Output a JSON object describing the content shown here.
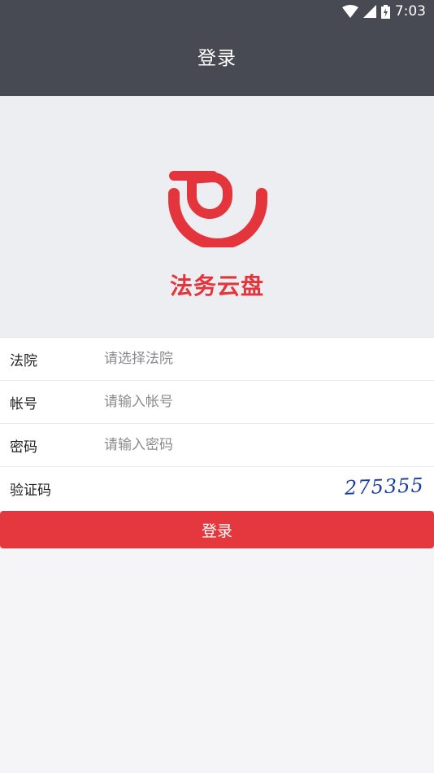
{
  "status_bar": {
    "time": "7:03",
    "icons": [
      "wifi-icon",
      "cell-signal-icon",
      "battery-icon"
    ]
  },
  "header": {
    "title": "登录"
  },
  "brand": {
    "name": "法务云盘",
    "color": "#e4343c",
    "logo_icon": "smile-logo-icon"
  },
  "form": {
    "court": {
      "label": "法院",
      "placeholder": "请选择法院",
      "value": ""
    },
    "account": {
      "label": "帐号",
      "placeholder": "请输入帐号",
      "value": ""
    },
    "password": {
      "label": "密码",
      "placeholder": "请输入密码",
      "value": ""
    },
    "captcha": {
      "label": "验证码",
      "value": "",
      "image_text": "275355"
    }
  },
  "login_button": {
    "label": "登录",
    "color": "#e5383e"
  },
  "colors": {
    "app_bar": "#474a52",
    "hero_bg": "#eceef1",
    "page_bg": "#f5f5f7"
  }
}
